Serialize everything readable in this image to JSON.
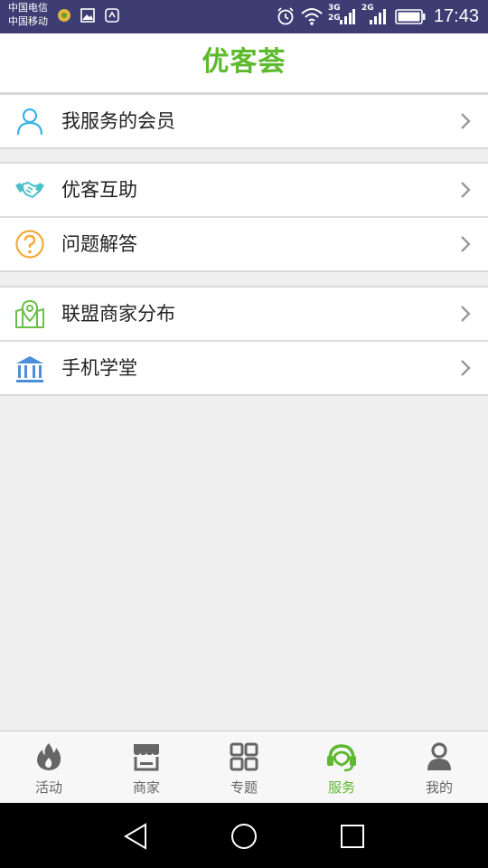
{
  "status_bar": {
    "carrier_1": "中国电信",
    "carrier_2": "中国移动",
    "network_1": "3G",
    "network_2": "2G",
    "network_3": "2G",
    "time": "17:43"
  },
  "header": {
    "title": "优客荟"
  },
  "menu": {
    "group1": [
      {
        "label": "我服务的会员",
        "icon": "user-icon"
      }
    ],
    "group2": [
      {
        "label": "优客互助",
        "icon": "handshake-icon"
      },
      {
        "label": "问题解答",
        "icon": "question-icon"
      }
    ],
    "group3": [
      {
        "label": "联盟商家分布",
        "icon": "map-pin-icon"
      },
      {
        "label": "手机学堂",
        "icon": "school-icon"
      }
    ]
  },
  "tabbar": {
    "items": [
      {
        "label": "活动",
        "icon": "flame-icon",
        "active": false
      },
      {
        "label": "商家",
        "icon": "store-icon",
        "active": false
      },
      {
        "label": "专题",
        "icon": "grid-icon",
        "active": false
      },
      {
        "label": "服务",
        "icon": "headset-icon",
        "active": true
      },
      {
        "label": "我的",
        "icon": "person-icon",
        "active": false
      }
    ]
  },
  "colors": {
    "accent": "#5db92d",
    "statusbar": "#3d3c73",
    "tab_inactive": "#666666",
    "background": "#efefef"
  }
}
